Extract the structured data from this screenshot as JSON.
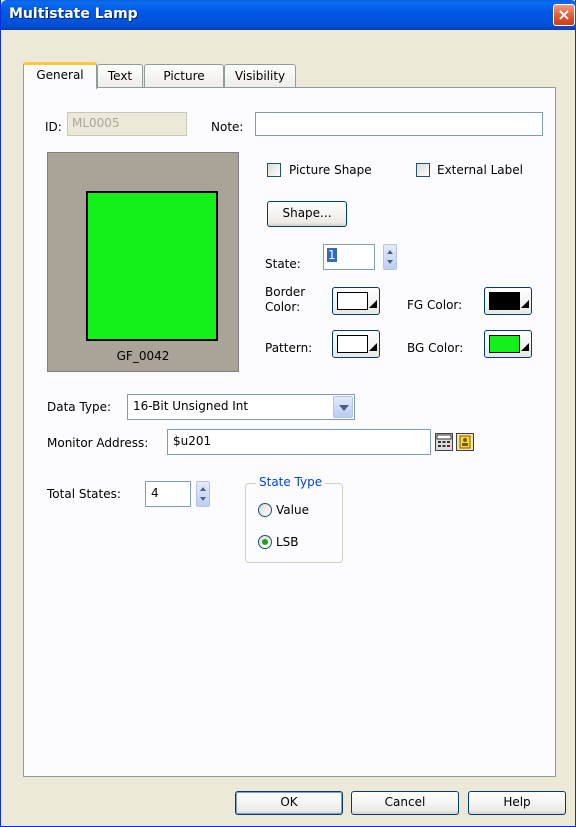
{
  "window": {
    "title": "Multistate Lamp",
    "close_glyph": "×"
  },
  "tabs": [
    "General",
    "Text",
    "Picture",
    "Visibility"
  ],
  "general": {
    "id_label": "ID:",
    "id_value": "ML0005",
    "note_label": "Note:",
    "note_value": "",
    "preview_name": "GF_0042",
    "preview_color": "#14f01a",
    "picture_shape_label": "Picture Shape",
    "external_label_label": "External Label",
    "shape_button": "Shape...",
    "state_label": "State:",
    "state_value": "1",
    "border_color_label_1": "Border",
    "border_color_label_2": "Color:",
    "fg_color_label": "FG Color:",
    "pattern_label": "Pattern:",
    "bg_color_label": "BG Color:",
    "colors": {
      "border": "#ffffff",
      "fg": "#000000",
      "pattern": "#ffffff",
      "bg": "#14f01a"
    },
    "data_type_label": "Data Type:",
    "data_type_value": "16-Bit Unsigned Int",
    "monitor_address_label": "Monitor Address:",
    "monitor_address_value": "$u201",
    "total_states_label": "Total States:",
    "total_states_value": "4",
    "state_type_legend": "State Type",
    "state_type_options": [
      "Value",
      "LSB"
    ],
    "state_type_selected": "LSB"
  },
  "footer": {
    "ok": "OK",
    "cancel": "Cancel",
    "help": "Help"
  }
}
